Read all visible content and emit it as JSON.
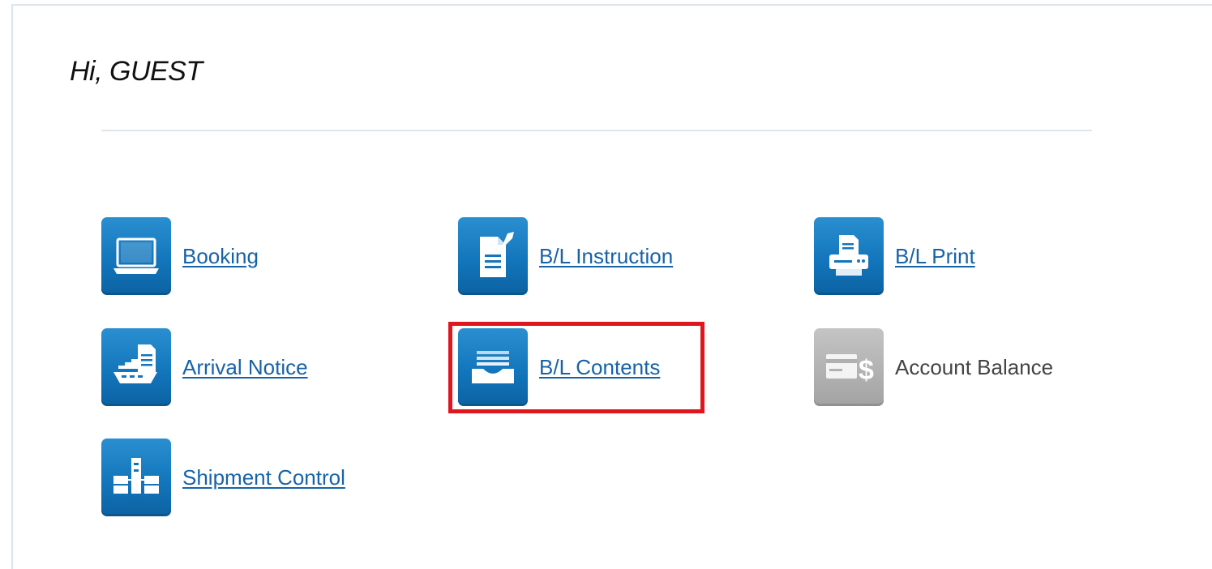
{
  "greeting": "Hi, GUEST",
  "colors": {
    "accent": "#1376bc",
    "link": "#1763a8",
    "disabled_icon": "#b0b0b0",
    "highlight": "#e0161f"
  },
  "menu": {
    "booking": {
      "label": "Booking",
      "icon": "laptop-icon",
      "enabled": true
    },
    "bl_instruction": {
      "label": "B/L Instruction",
      "icon": "document-edit-icon",
      "enabled": true
    },
    "bl_print": {
      "label": "B/L Print",
      "icon": "printer-icon",
      "enabled": true
    },
    "arrival_notice": {
      "label": "Arrival Notice",
      "icon": "ship-document-icon",
      "enabled": true
    },
    "bl_contents": {
      "label": "B/L Contents",
      "icon": "inbox-tray-icon",
      "enabled": true,
      "highlighted": true
    },
    "account_balance": {
      "label": "Account Balance",
      "icon": "card-dollar-icon",
      "enabled": false
    },
    "shipment_control": {
      "label": "Shipment Control",
      "icon": "shipment-control-icon",
      "enabled": true
    }
  }
}
